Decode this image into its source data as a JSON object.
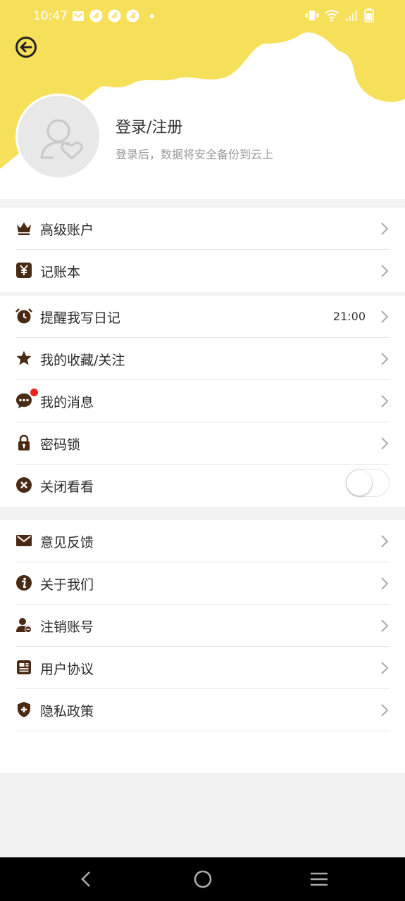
{
  "status_bar": {
    "time": "10:47"
  },
  "header": {
    "login_title": "登录/注册",
    "login_subtitle": "登录后，数据将安全备份到云上"
  },
  "colors": {
    "accent": "#f6e05a",
    "icon": "#4a2a12",
    "badge": "#f0201d"
  },
  "sections": [
    {
      "items": [
        {
          "icon": "crown-icon",
          "label": "高级账户"
        },
        {
          "icon": "yen-icon",
          "label": "记账本"
        }
      ]
    },
    {
      "items": [
        {
          "icon": "alarm-clock-icon",
          "label": "提醒我写日记",
          "value": "21:00"
        },
        {
          "icon": "star-icon",
          "label": "我的收藏/关注"
        },
        {
          "icon": "chat-bubble-icon",
          "label": "我的消息",
          "has_badge": true
        },
        {
          "icon": "lock-icon",
          "label": "密码锁"
        },
        {
          "icon": "close-circle-icon",
          "label": "关闭看看",
          "toggle": false
        }
      ]
    },
    {
      "items": [
        {
          "icon": "mail-icon",
          "label": "意见反馈"
        },
        {
          "icon": "info-icon",
          "label": "关于我们"
        },
        {
          "icon": "user-remove-icon",
          "label": "注销账号"
        },
        {
          "icon": "document-icon",
          "label": "用户协议"
        },
        {
          "icon": "shield-plus-icon",
          "label": "隐私政策"
        }
      ]
    }
  ]
}
